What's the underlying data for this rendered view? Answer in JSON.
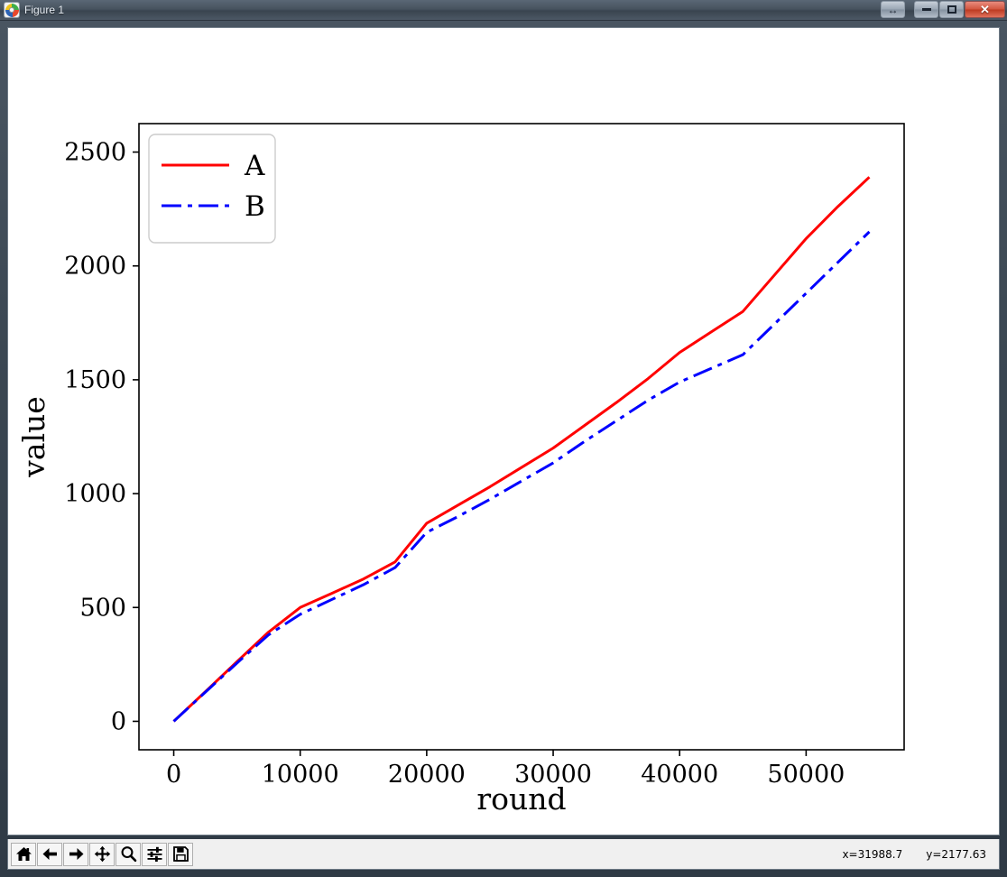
{
  "window": {
    "title": "Figure 1",
    "icon": "matplotlib-icon",
    "buttons": {
      "resize_label": "↔",
      "minimize_label": "minimize",
      "maximize_label": "maximize",
      "close_label": "✕"
    }
  },
  "toolbar": {
    "items": [
      {
        "name": "home-icon",
        "tooltip": "Home"
      },
      {
        "name": "back-arrow-icon",
        "tooltip": "Back"
      },
      {
        "name": "forward-arrow-icon",
        "tooltip": "Forward"
      },
      {
        "name": "pan-move-icon",
        "tooltip": "Pan"
      },
      {
        "name": "zoom-magnifier-icon",
        "tooltip": "Zoom to rectangle"
      },
      {
        "name": "subplot-sliders-icon",
        "tooltip": "Configure subplots"
      },
      {
        "name": "save-floppy-icon",
        "tooltip": "Save the figure"
      }
    ],
    "coord_x": "x=31988.7",
    "coord_y": "y=2177.63"
  },
  "chart_data": {
    "type": "line",
    "title": "",
    "xlabel": "round",
    "ylabel": "value",
    "xlim": [
      -2750,
      57750
    ],
    "ylim": [
      -125,
      2625
    ],
    "xticks": [
      0,
      10000,
      20000,
      30000,
      40000,
      50000
    ],
    "yticks": [
      0,
      500,
      1000,
      1500,
      2000,
      2500
    ],
    "xticklabels": [
      "0",
      "10000",
      "20000",
      "30000",
      "40000",
      "50000"
    ],
    "yticklabels": [
      "0",
      "500",
      "1000",
      "1500",
      "2000",
      "2500"
    ],
    "grid": false,
    "legend_position": "upper left",
    "colors": {
      "A": "#FF0000",
      "B": "#0000FF"
    },
    "x": [
      0,
      2500,
      5000,
      7500,
      10000,
      12500,
      15000,
      17500,
      20000,
      22500,
      25000,
      27500,
      30000,
      32500,
      35000,
      37500,
      40000,
      42500,
      45000,
      47500,
      50000,
      52500,
      55000
    ],
    "series": [
      {
        "name": "A",
        "label": "A",
        "color": "#FF0000",
        "linestyle": "solid",
        "linewidth": 3,
        "values": [
          0,
          130,
          262,
          392,
          500,
          562,
          625,
          700,
          870,
          950,
          1030,
          1115,
          1200,
          1300,
          1400,
          1505,
          1620,
          1710,
          1800,
          1960,
          2120,
          2260,
          2390
        ]
      },
      {
        "name": "B",
        "label": "B",
        "color": "#0000FF",
        "linestyle": "dashdot",
        "linewidth": 3,
        "values": [
          0,
          128,
          256,
          380,
          470,
          535,
          600,
          675,
          830,
          900,
          975,
          1055,
          1135,
          1230,
          1320,
          1410,
          1490,
          1550,
          1610,
          1745,
          1880,
          2015,
          2150
        ]
      }
    ]
  }
}
